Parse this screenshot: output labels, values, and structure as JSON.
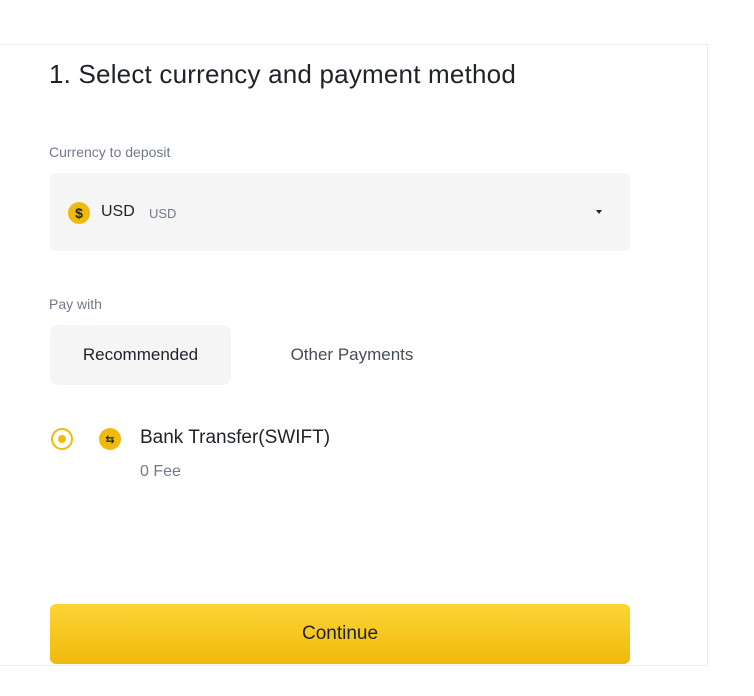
{
  "section": {
    "title": "1. Select currency and payment method"
  },
  "currency": {
    "label": "Currency to deposit",
    "icon": "dollar-coin-icon",
    "icon_glyph": "$",
    "code": "USD",
    "name": "USD",
    "dropdown_icon": "caret-down-icon"
  },
  "payment": {
    "label": "Pay with",
    "tabs": [
      {
        "label": "Recommended",
        "selected": true
      },
      {
        "label": "Other Payments",
        "selected": false
      }
    ],
    "methods": [
      {
        "name": "Bank Transfer(SWIFT)",
        "fee": "0 Fee",
        "icon": "bank-transfer-icon",
        "icon_glyph": "⇆",
        "selected": true
      }
    ]
  },
  "actions": {
    "continue_label": "Continue"
  },
  "colors": {
    "accent": "#f0b90b",
    "accent_light": "#fcd535",
    "text_primary": "#1e2329",
    "text_secondary": "#707a8a",
    "surface": "#f5f5f5"
  }
}
